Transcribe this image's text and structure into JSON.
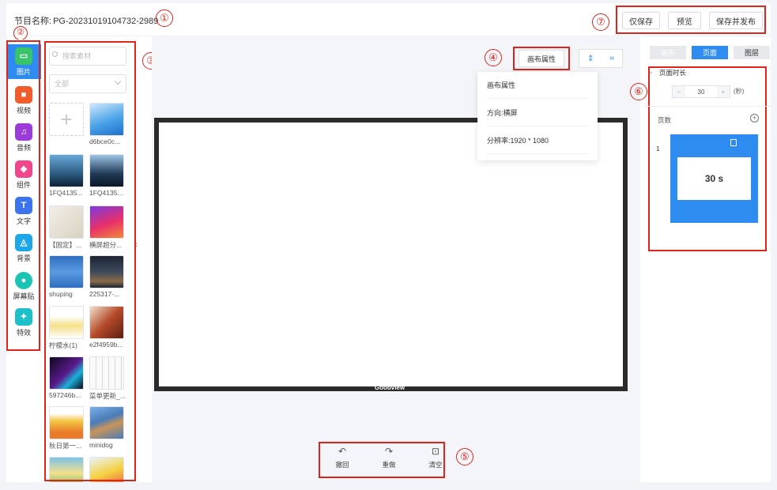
{
  "header": {
    "program_label": "节目名称:",
    "program_name": "PG-20231019104732-2989",
    "actions": [
      "仅保存",
      "预览",
      "保存并发布"
    ]
  },
  "annotations": [
    "①",
    "②",
    "③",
    "④",
    "⑤",
    "⑥",
    "⑦"
  ],
  "sidebar": {
    "items": [
      {
        "label": "图片",
        "icon": "image-icon",
        "color": "#3ac46a",
        "active": true
      },
      {
        "label": "视频",
        "icon": "video-icon",
        "color": "#f25c2a"
      },
      {
        "label": "音频",
        "icon": "music-icon",
        "color": "#9b3bd9"
      },
      {
        "label": "组件",
        "icon": "cube-icon",
        "color": "#f0468c"
      },
      {
        "label": "文字",
        "icon": "text-icon",
        "color": "#3c74f0"
      },
      {
        "label": "背景",
        "icon": "paint-bucket-icon",
        "color": "#1ea7e8"
      },
      {
        "label": "屏幕贴",
        "icon": "circle-icon",
        "color": "#1cc4b4"
      },
      {
        "label": "特效",
        "icon": "magic-wand-icon",
        "color": "#1cc0c9"
      }
    ]
  },
  "materials": {
    "search_placeholder": "搜索素材",
    "filter_value": "全部",
    "items": [
      {
        "label": "d6bce0c...",
        "color": "#4aa3e8"
      },
      {
        "label": "1FQ4135...",
        "color": "#2c5a80"
      },
      {
        "label": "1FQ4135...",
        "color": "#1f3a55"
      },
      {
        "label": "【固定】...",
        "color": "#e8e4dc"
      },
      {
        "label": "横屏超分...",
        "color": "#c23a7a"
      },
      {
        "label": "shuping",
        "color": "#3d78c4"
      },
      {
        "label": "225317-...",
        "color": "#2a3140"
      },
      {
        "label": "柠檬水(1)",
        "color": "#f5e9b8"
      },
      {
        "label": "e2f4959b...",
        "color": "#b54a2a"
      },
      {
        "label": "597246b...",
        "color": "#1a1430"
      },
      {
        "label": "菜单更新_...",
        "color": "#f0f0f0"
      },
      {
        "label": "秋日第一...",
        "color": "#f5c542"
      },
      {
        "label": "minidog",
        "color": "#4a7cb8"
      },
      {
        "label": "",
        "color": "#7cc3e8"
      },
      {
        "label": "",
        "color": "#e8f4f8"
      }
    ]
  },
  "canvas": {
    "attr_button": "画布属性",
    "footer": "Goodview",
    "dropdown": {
      "title": "画布属性",
      "direction": "方向:横屏",
      "resolution": "分辨率:1920 * 1080"
    }
  },
  "tools": [
    {
      "label": "撤回",
      "glyph": "↶"
    },
    {
      "label": "重做",
      "glyph": "↷"
    },
    {
      "label": "清空",
      "glyph": "⊡"
    }
  ],
  "right_panel": {
    "tabs": [
      "画布",
      "页面",
      "图层"
    ],
    "active_tab": "页面",
    "duration_title": "页面时长",
    "duration_value": "30",
    "duration_unit": "(秒)",
    "pages_title": "页数",
    "page_number": "1",
    "page_duration": "30 s"
  }
}
